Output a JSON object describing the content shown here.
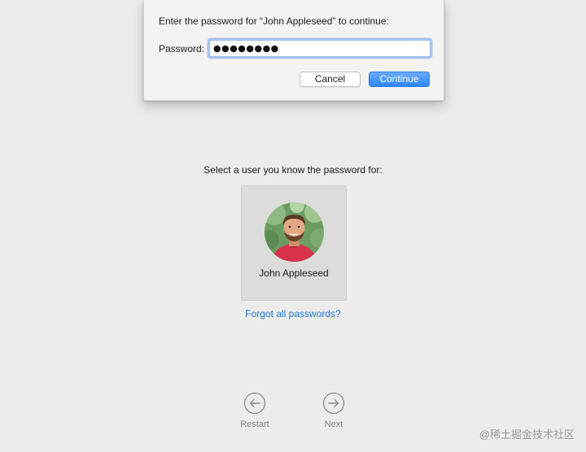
{
  "dialog": {
    "prompt": "Enter the password for “John Appleseed” to continue:",
    "password_label": "Password:",
    "password_value": "●●●●●●●●",
    "cancel_label": "Cancel",
    "continue_label": "Continue"
  },
  "main": {
    "select_prompt": "Select a user you know the password for:",
    "user": {
      "name": "John Appleseed",
      "avatar_icon": "user-photo"
    },
    "forgot_link": "Forgot all passwords?"
  },
  "nav": {
    "restart": {
      "label": "Restart",
      "icon": "arrow-left-circle-icon"
    },
    "next": {
      "label": "Next",
      "icon": "arrow-right-circle-icon"
    }
  },
  "watermark": "@稀土掘金技术社区",
  "colors": {
    "background": "#ececea",
    "accent": "#2f86f6",
    "link": "#1f74d9"
  }
}
